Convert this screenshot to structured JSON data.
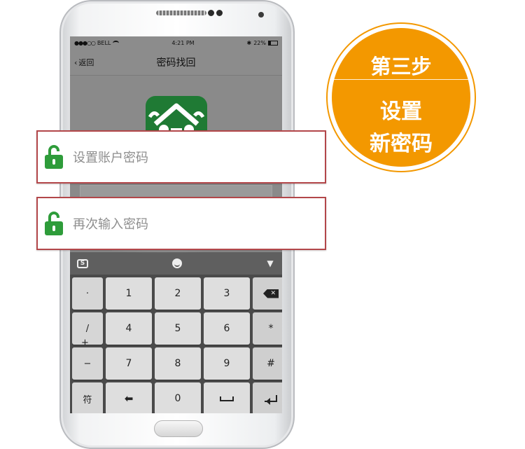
{
  "statusbar": {
    "carrier": "BELL",
    "time": "4:21 PM",
    "battery": "22%",
    "signal_dots": "●●●○○"
  },
  "navbar": {
    "back_label": "返回",
    "title": "密码找回"
  },
  "inputs": {
    "password": "设置账户密码",
    "confirm_password": "再次输入密码"
  },
  "keyboard": {
    "toolbar": [
      "sogou-icon",
      "smile-icon",
      "down-arrow-icon"
    ],
    "side_keys": [
      "·",
      "/",
      "+",
      "−",
      "符"
    ],
    "rows": [
      [
        "1",
        "2",
        "3"
      ],
      [
        "4",
        "5",
        "6"
      ],
      [
        "7",
        "8",
        "9"
      ],
      [
        "",
        "0",
        ""
      ]
    ],
    "right_keys": [
      "",
      "*",
      "#",
      ""
    ],
    "logo_letter": "S"
  },
  "badge": {
    "step": "第三步",
    "line1": "设置",
    "line2": "新密码"
  },
  "colors": {
    "accent_orange": "#f39800",
    "lock_green": "#2e9c3a",
    "box_border": "#b3474a",
    "app_green": "#1f7a34"
  }
}
